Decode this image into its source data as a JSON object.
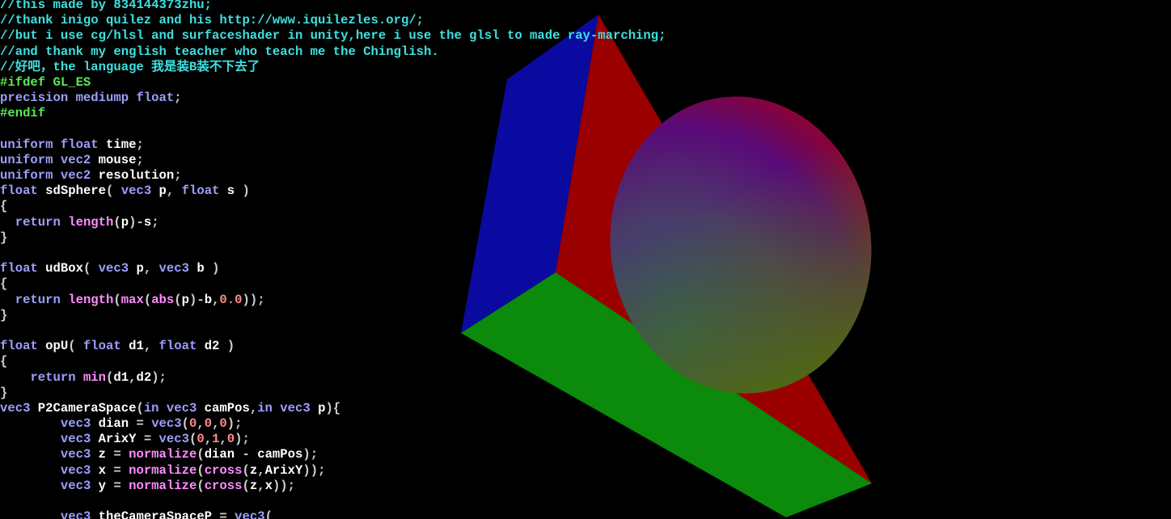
{
  "editor": {
    "colors": {
      "background": "#000000",
      "comment": "#3fe0e0",
      "preprocessor": "#58e858",
      "type_keyword": "#9e9eff",
      "builtin_function": "#ff8cff",
      "number": "#ff8c8c",
      "identifier": "#ffffff",
      "punctuation": "#cfcfcf"
    },
    "lines": [
      [
        {
          "t": "comment",
          "v": "//this made by 834144373zhu;"
        }
      ],
      [
        {
          "t": "comment",
          "v": "//thank inigo quilez and his http://www.iquilezles.org/;"
        }
      ],
      [
        {
          "t": "comment",
          "v": "//but i use cg/hlsl and surfaceshader in unity,here i use the glsl to made ray-marching;"
        }
      ],
      [
        {
          "t": "comment",
          "v": "//and thank my english teacher who teach me the Chinglish."
        }
      ],
      [
        {
          "t": "comment",
          "v": "//好吧，the language 我是装B装不下去了"
        }
      ],
      [
        {
          "t": "preproc",
          "v": "#ifdef GL_ES"
        }
      ],
      [
        {
          "t": "type",
          "v": "precision mediump float"
        },
        {
          "t": "punct",
          "v": ";"
        }
      ],
      [
        {
          "t": "preproc",
          "v": "#endif"
        }
      ],
      [],
      [
        {
          "t": "type",
          "v": "uniform float"
        },
        {
          "t": "plain",
          "v": " time"
        },
        {
          "t": "punct",
          "v": ";"
        }
      ],
      [
        {
          "t": "type",
          "v": "uniform vec2"
        },
        {
          "t": "plain",
          "v": " mouse"
        },
        {
          "t": "punct",
          "v": ";"
        }
      ],
      [
        {
          "t": "type",
          "v": "uniform vec2"
        },
        {
          "t": "plain",
          "v": " resolution"
        },
        {
          "t": "punct",
          "v": ";"
        }
      ],
      [
        {
          "t": "type",
          "v": "float"
        },
        {
          "t": "plain",
          "v": " sdSphere"
        },
        {
          "t": "punct",
          "v": "( "
        },
        {
          "t": "type",
          "v": "vec3"
        },
        {
          "t": "plain",
          "v": " p"
        },
        {
          "t": "punct",
          "v": ", "
        },
        {
          "t": "type",
          "v": "float"
        },
        {
          "t": "plain",
          "v": " s "
        },
        {
          "t": "punct",
          "v": ")"
        }
      ],
      [
        {
          "t": "punct",
          "v": "{"
        }
      ],
      [
        {
          "t": "plain",
          "v": "  "
        },
        {
          "t": "type",
          "v": "return"
        },
        {
          "t": "plain",
          "v": " "
        },
        {
          "t": "func",
          "v": "length"
        },
        {
          "t": "punct",
          "v": "("
        },
        {
          "t": "plain",
          "v": "p"
        },
        {
          "t": "punct",
          "v": ")-"
        },
        {
          "t": "plain",
          "v": "s"
        },
        {
          "t": "punct",
          "v": ";"
        }
      ],
      [
        {
          "t": "punct",
          "v": "}"
        }
      ],
      [],
      [
        {
          "t": "type",
          "v": "float"
        },
        {
          "t": "plain",
          "v": " udBox"
        },
        {
          "t": "punct",
          "v": "( "
        },
        {
          "t": "type",
          "v": "vec3"
        },
        {
          "t": "plain",
          "v": " p"
        },
        {
          "t": "punct",
          "v": ", "
        },
        {
          "t": "type",
          "v": "vec3"
        },
        {
          "t": "plain",
          "v": " b "
        },
        {
          "t": "punct",
          "v": ")"
        }
      ],
      [
        {
          "t": "punct",
          "v": "{"
        }
      ],
      [
        {
          "t": "plain",
          "v": "  "
        },
        {
          "t": "type",
          "v": "return"
        },
        {
          "t": "plain",
          "v": " "
        },
        {
          "t": "func",
          "v": "length"
        },
        {
          "t": "punct",
          "v": "("
        },
        {
          "t": "func",
          "v": "max"
        },
        {
          "t": "punct",
          "v": "("
        },
        {
          "t": "func",
          "v": "abs"
        },
        {
          "t": "punct",
          "v": "("
        },
        {
          "t": "plain",
          "v": "p"
        },
        {
          "t": "punct",
          "v": ")-"
        },
        {
          "t": "plain",
          "v": "b"
        },
        {
          "t": "punct",
          "v": ","
        },
        {
          "t": "num",
          "v": "0.0"
        },
        {
          "t": "punct",
          "v": "));"
        }
      ],
      [
        {
          "t": "punct",
          "v": "}"
        }
      ],
      [],
      [
        {
          "t": "type",
          "v": "float"
        },
        {
          "t": "plain",
          "v": " opU"
        },
        {
          "t": "punct",
          "v": "( "
        },
        {
          "t": "type",
          "v": "float"
        },
        {
          "t": "plain",
          "v": " d1"
        },
        {
          "t": "punct",
          "v": ", "
        },
        {
          "t": "type",
          "v": "float"
        },
        {
          "t": "plain",
          "v": " d2 "
        },
        {
          "t": "punct",
          "v": ")"
        }
      ],
      [
        {
          "t": "punct",
          "v": "{"
        }
      ],
      [
        {
          "t": "plain",
          "v": "    "
        },
        {
          "t": "type",
          "v": "return"
        },
        {
          "t": "plain",
          "v": " "
        },
        {
          "t": "func",
          "v": "min"
        },
        {
          "t": "punct",
          "v": "("
        },
        {
          "t": "plain",
          "v": "d1"
        },
        {
          "t": "punct",
          "v": ","
        },
        {
          "t": "plain",
          "v": "d2"
        },
        {
          "t": "punct",
          "v": ");"
        }
      ],
      [
        {
          "t": "punct",
          "v": "}"
        }
      ],
      [
        {
          "t": "type",
          "v": "vec3"
        },
        {
          "t": "plain",
          "v": " P2CameraSpace"
        },
        {
          "t": "punct",
          "v": "("
        },
        {
          "t": "type",
          "v": "in vec3"
        },
        {
          "t": "plain",
          "v": " camPos"
        },
        {
          "t": "punct",
          "v": ","
        },
        {
          "t": "type",
          "v": "in vec3"
        },
        {
          "t": "plain",
          "v": " p"
        },
        {
          "t": "punct",
          "v": "){"
        }
      ],
      [
        {
          "t": "plain",
          "v": "        "
        },
        {
          "t": "type",
          "v": "vec3"
        },
        {
          "t": "plain",
          "v": " dian "
        },
        {
          "t": "punct",
          "v": "= "
        },
        {
          "t": "type",
          "v": "vec3"
        },
        {
          "t": "punct",
          "v": "("
        },
        {
          "t": "num",
          "v": "0"
        },
        {
          "t": "punct",
          "v": ","
        },
        {
          "t": "num",
          "v": "0"
        },
        {
          "t": "punct",
          "v": ","
        },
        {
          "t": "num",
          "v": "0"
        },
        {
          "t": "punct",
          "v": ");"
        }
      ],
      [
        {
          "t": "plain",
          "v": "        "
        },
        {
          "t": "type",
          "v": "vec3"
        },
        {
          "t": "plain",
          "v": " ArixY "
        },
        {
          "t": "punct",
          "v": "= "
        },
        {
          "t": "type",
          "v": "vec3"
        },
        {
          "t": "punct",
          "v": "("
        },
        {
          "t": "num",
          "v": "0"
        },
        {
          "t": "punct",
          "v": ","
        },
        {
          "t": "num",
          "v": "1"
        },
        {
          "t": "punct",
          "v": ","
        },
        {
          "t": "num",
          "v": "0"
        },
        {
          "t": "punct",
          "v": ");"
        }
      ],
      [
        {
          "t": "plain",
          "v": "        "
        },
        {
          "t": "type",
          "v": "vec3"
        },
        {
          "t": "plain",
          "v": " z "
        },
        {
          "t": "punct",
          "v": "= "
        },
        {
          "t": "func",
          "v": "normalize"
        },
        {
          "t": "punct",
          "v": "("
        },
        {
          "t": "plain",
          "v": "dian "
        },
        {
          "t": "punct",
          "v": "- "
        },
        {
          "t": "plain",
          "v": "camPos"
        },
        {
          "t": "punct",
          "v": ");"
        }
      ],
      [
        {
          "t": "plain",
          "v": "        "
        },
        {
          "t": "type",
          "v": "vec3"
        },
        {
          "t": "plain",
          "v": " x "
        },
        {
          "t": "punct",
          "v": "= "
        },
        {
          "t": "func",
          "v": "normalize"
        },
        {
          "t": "punct",
          "v": "("
        },
        {
          "t": "func",
          "v": "cross"
        },
        {
          "t": "punct",
          "v": "("
        },
        {
          "t": "plain",
          "v": "z"
        },
        {
          "t": "punct",
          "v": ","
        },
        {
          "t": "plain",
          "v": "ArixY"
        },
        {
          "t": "punct",
          "v": "));"
        }
      ],
      [
        {
          "t": "plain",
          "v": "        "
        },
        {
          "t": "type",
          "v": "vec3"
        },
        {
          "t": "plain",
          "v": " y "
        },
        {
          "t": "punct",
          "v": "= "
        },
        {
          "t": "func",
          "v": "normalize"
        },
        {
          "t": "punct",
          "v": "("
        },
        {
          "t": "func",
          "v": "cross"
        },
        {
          "t": "punct",
          "v": "("
        },
        {
          "t": "plain",
          "v": "z"
        },
        {
          "t": "punct",
          "v": ","
        },
        {
          "t": "plain",
          "v": "x"
        },
        {
          "t": "punct",
          "v": "));"
        }
      ],
      [],
      [
        {
          "t": "plain",
          "v": "        "
        },
        {
          "t": "type",
          "v": "vec3"
        },
        {
          "t": "plain",
          "v": " theCameraSpaceP "
        },
        {
          "t": "punct",
          "v": "= "
        },
        {
          "t": "type",
          "v": "vec3"
        },
        {
          "t": "punct",
          "v": "("
        }
      ]
    ]
  },
  "render": {
    "scene": "ray-marched box unioned with sphere",
    "colors": {
      "face_left": "#0a0aa0",
      "face_right": "#9a0000",
      "face_bottom": "#0b8a0b",
      "sphere_top": "#5a0a78",
      "sphere_right": "#9a0020",
      "sphere_mid": "#2f5a6a",
      "sphere_bottom": "#4f6a10"
    }
  }
}
